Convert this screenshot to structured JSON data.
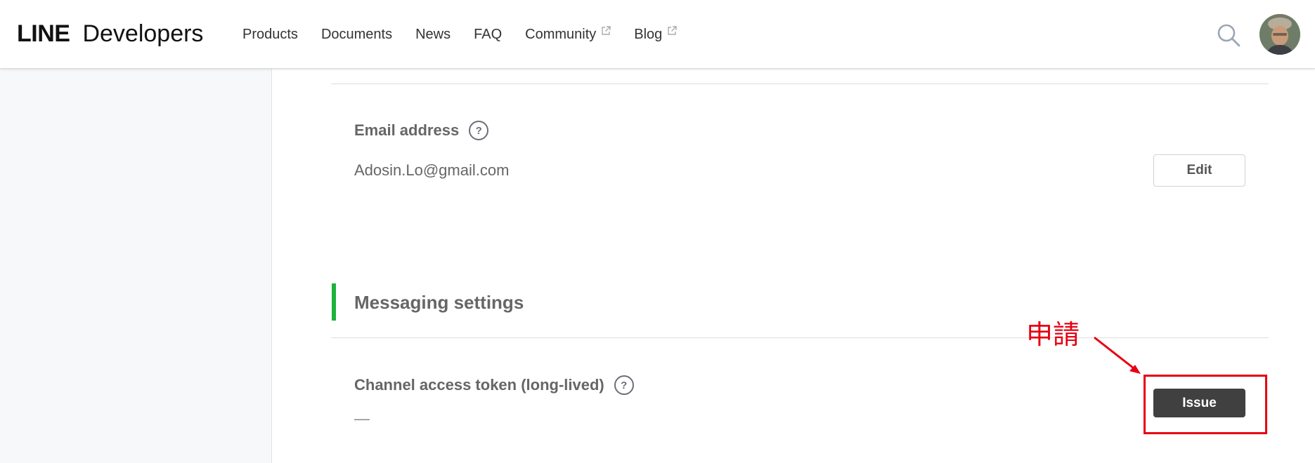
{
  "header": {
    "logo_line": "LINE",
    "logo_developers": "Developers",
    "nav": [
      {
        "label": "Products",
        "external": false
      },
      {
        "label": "Documents",
        "external": false
      },
      {
        "label": "News",
        "external": false
      },
      {
        "label": "FAQ",
        "external": false
      },
      {
        "label": "Community",
        "external": true
      },
      {
        "label": "Blog",
        "external": true
      }
    ],
    "search_icon": "search-icon",
    "avatar_icon": "user-avatar"
  },
  "email": {
    "label": "Email address",
    "help": "?",
    "value": "Adosin.Lo@gmail.com",
    "edit_label": "Edit"
  },
  "messaging": {
    "section_title": "Messaging settings",
    "token_label": "Channel access token (long-lived)",
    "help": "?",
    "token_value": "—",
    "issue_label": "Issue"
  },
  "annotation": {
    "text": "申請",
    "color": "#e60012"
  },
  "colors": {
    "accent_green": "#1db33b",
    "issue_button": "#404040"
  }
}
